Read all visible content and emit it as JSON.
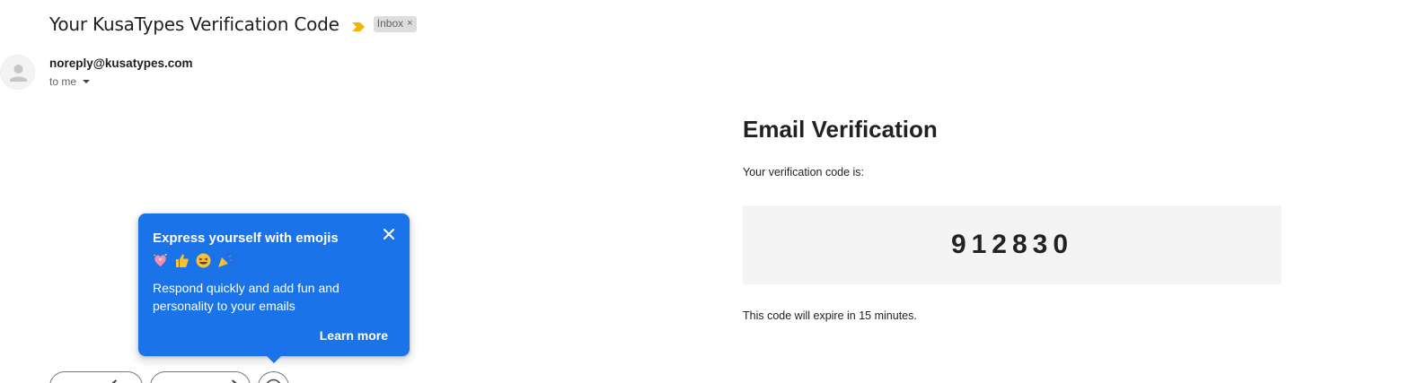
{
  "email": {
    "subject": "Your KusaTypes Verification Code",
    "label": "Inbox",
    "label_close": "×",
    "sender": "noreply@kusatypes.com",
    "recipient": "to me"
  },
  "body": {
    "heading": "Email Verification",
    "intro": "Your verification code is:",
    "code": "912830",
    "expiry": "This code will expire in 15 minutes."
  },
  "tooltip": {
    "title": "Express yourself with emojis",
    "emojis": [
      "sparkling-heart",
      "thumbs-up",
      "grinning-squinting-face",
      "party-popper"
    ],
    "body": "Respond quickly and add fun and personality to your emails",
    "link": "Learn more"
  },
  "colors": {
    "tooltip_bg": "#1a73e8",
    "importance_marker": "#f4b400",
    "code_box_bg": "#f4f4f4"
  }
}
